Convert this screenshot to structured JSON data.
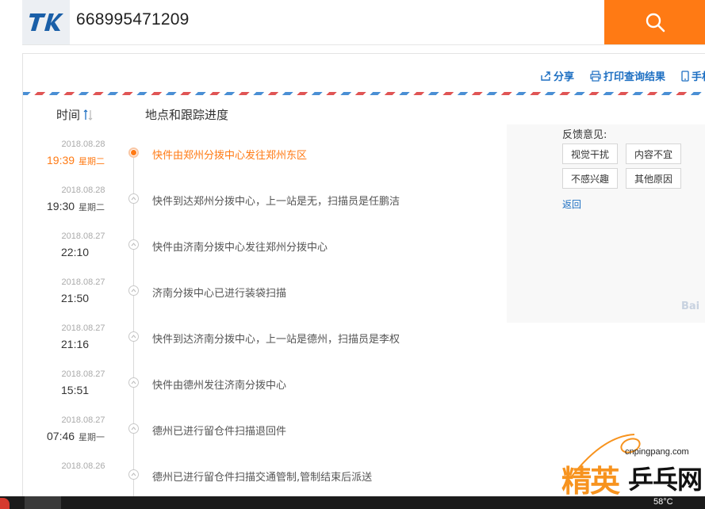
{
  "search": {
    "tracking_number": "668995471209"
  },
  "actions": {
    "share": "分享",
    "print": "打印查询结果",
    "mobile": "手机"
  },
  "headers": {
    "time": "时间",
    "place": "地点和跟踪进度"
  },
  "timeline": [
    {
      "date": "2018.08.28",
      "time": "19:39",
      "weekday": "星期二",
      "desc": "快件由郑州分拨中心发往郑州东区",
      "current": true
    },
    {
      "date": "2018.08.28",
      "time": "19:30",
      "weekday": "星期二",
      "desc": "快件到达郑州分拨中心，上一站是无，扫描员是任鹏洁"
    },
    {
      "date": "2018.08.27",
      "time": "22:10",
      "weekday": "",
      "desc": "快件由济南分拨中心发往郑州分拨中心"
    },
    {
      "date": "2018.08.27",
      "time": "21:50",
      "weekday": "",
      "desc": "济南分拨中心已进行装袋扫描"
    },
    {
      "date": "2018.08.27",
      "time": "21:16",
      "weekday": "",
      "desc": "快件到达济南分拨中心，上一站是德州，扫描员是李权"
    },
    {
      "date": "2018.08.27",
      "time": "15:51",
      "weekday": "",
      "desc": "快件由德州发往济南分拨中心"
    },
    {
      "date": "2018.08.27",
      "time": "07:46",
      "weekday": "星期一",
      "desc": "德州已进行留仓件扫描退回件"
    },
    {
      "date": "2018.08.26",
      "time": "",
      "weekday": "",
      "desc": "德州已进行留仓件扫描交通管制,管制结束后派送"
    }
  ],
  "feedback": {
    "title": "反馈意见:",
    "options": [
      "视觉干扰",
      "内容不宜",
      "不感兴趣",
      "其他原因"
    ],
    "back": "返回",
    "brand": "Bai"
  },
  "watermark": {
    "url": "cnpingpang.com",
    "name_a": "精英",
    "name_b": "乒乓网"
  },
  "taskbar": {
    "temperature": "58°C"
  },
  "colors": {
    "accent": "#ff7a14",
    "link": "#1d6fc2"
  }
}
